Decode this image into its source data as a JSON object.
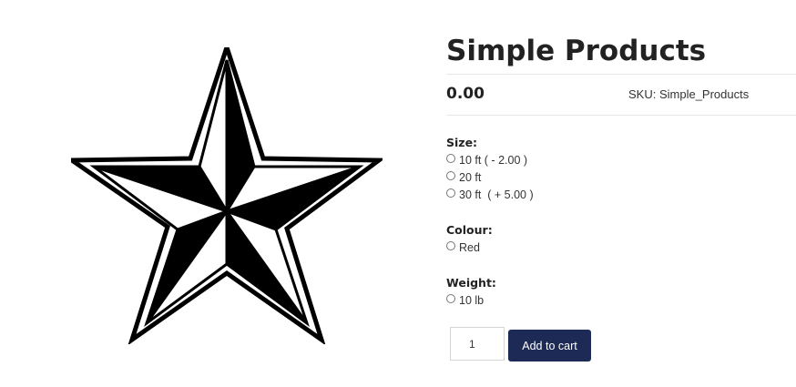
{
  "product": {
    "image_alt": "nautical star",
    "title": "Simple Products",
    "price": "0.00",
    "sku_label": "SKU:",
    "sku_value": "Simple_Products"
  },
  "attributes": {
    "size": {
      "label": "Size:",
      "options": [
        "10 ft ( - 2.00 )",
        "20 ft",
        "30 ft  ( + 5.00 )"
      ]
    },
    "colour": {
      "label": "Colour:",
      "options": [
        "Red"
      ]
    },
    "weight": {
      "label": "Weight:",
      "options": [
        "10 lb"
      ]
    }
  },
  "cart": {
    "quantity": "1",
    "add_to_cart_label": "Add to cart",
    "button_color": "#1c2a55"
  }
}
